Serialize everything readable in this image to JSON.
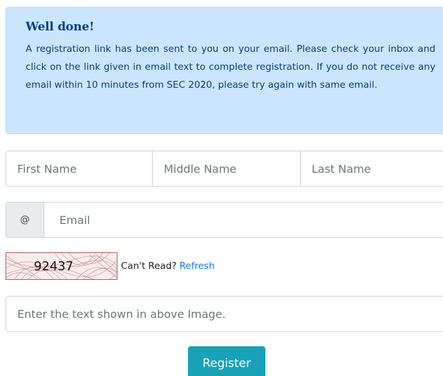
{
  "alert": {
    "title": "Well done!",
    "message": "A registration link has been sent to you on your email. Please check your inbox and click on the link given in email text to complete registration. If you do not receive any email within 10 minutes from SEC 2020, please try again with same email."
  },
  "form": {
    "first_name": {
      "placeholder": "First Name",
      "value": ""
    },
    "middle_name": {
      "placeholder": "Middle Name",
      "value": ""
    },
    "last_name": {
      "placeholder": "Last Name",
      "value": ""
    },
    "email": {
      "addon": "@",
      "placeholder": "Email",
      "value": ""
    },
    "captcha": {
      "code": "92437",
      "cant_read_label": "Can't Read?",
      "refresh_label": "Refresh"
    },
    "captcha_input": {
      "placeholder": "Enter the text shown in above Image.",
      "value": ""
    },
    "register_label": "Register"
  },
  "colors": {
    "alert_bg": "#cce5ff",
    "alert_text": "#004085",
    "link": "#007bff",
    "button": "#17a2b8"
  }
}
